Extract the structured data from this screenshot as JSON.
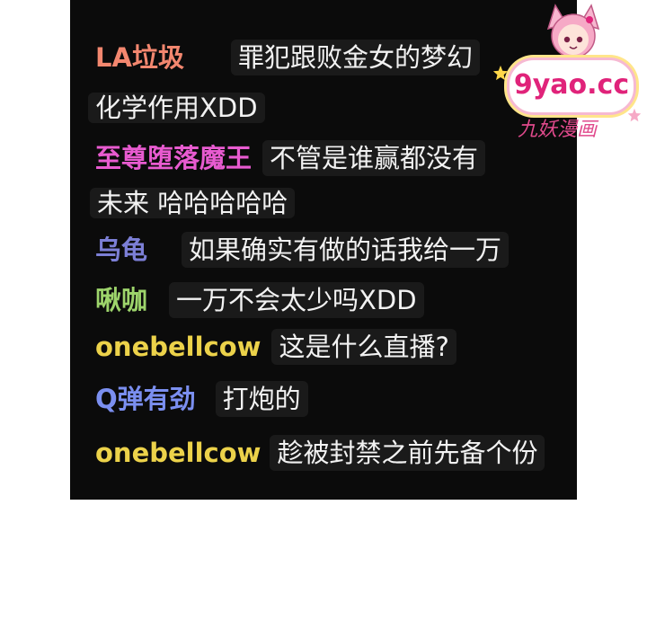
{
  "chat": {
    "messages": [
      {
        "user": "LA垃圾",
        "user_color": "#f3876f",
        "text": "罪犯跟败金女的梦幻",
        "continuation": "化学作用XDD"
      },
      {
        "user": "至尊堕落魔王",
        "user_color": "#e85bd0",
        "text": "不管是谁赢都没有",
        "continuation": "未来 哈哈哈哈哈"
      },
      {
        "user": "乌龟",
        "user_color": "#7c7fd6",
        "text": "如果确实有做的话我给一万"
      },
      {
        "user": "啾咖",
        "user_color": "#9dd46b",
        "text": "一万不会太少吗XDD"
      },
      {
        "user": "onebellcow",
        "user_color": "#ecd24a",
        "text": "这是什么直播?"
      },
      {
        "user": "Q弹有劲",
        "user_color": "#7b8ff0",
        "text": "打炮的"
      },
      {
        "user": "onebellcow",
        "user_color": "#ecd24a",
        "text": "趁被封禁之前先备个份"
      }
    ]
  },
  "watermark": {
    "domain": "9yao.cc",
    "subtitle": "九妖漫画"
  },
  "colors": {
    "panel_background": "#0b0b0b",
    "message_text": "#f2f2f2",
    "page_background": "#ffffff"
  }
}
